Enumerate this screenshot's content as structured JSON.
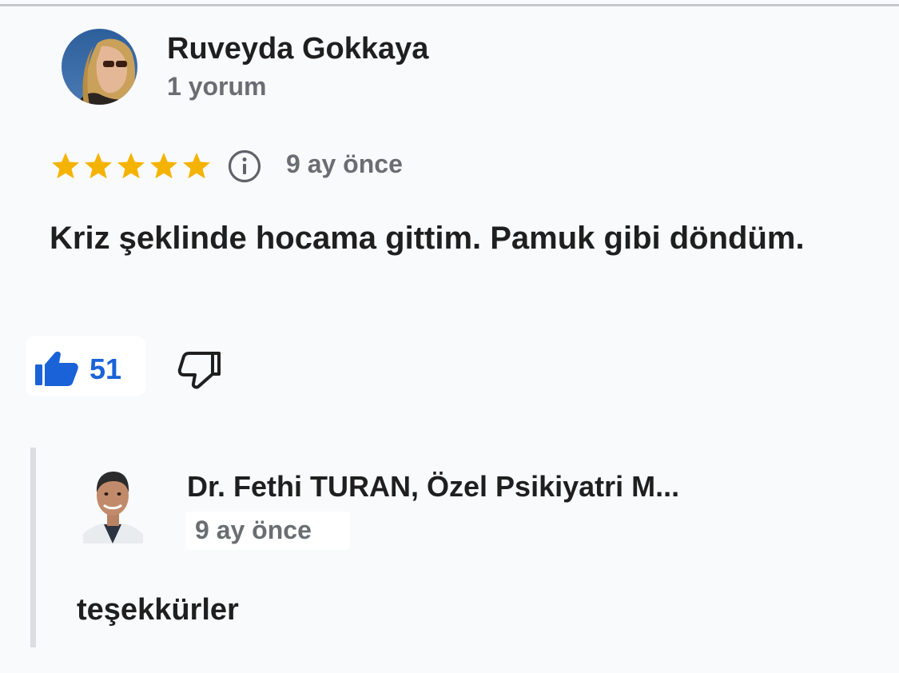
{
  "review": {
    "reviewer_name": "Ruveyda Gokkaya",
    "reviewer_meta": "1 yorum",
    "rating": 5,
    "rating_max": 5,
    "time": "9 ay önce",
    "text": "Kriz şeklinde hocama gittim. Pamuk gibi döndüm.",
    "like_count": "51",
    "star_color": "#f5b301",
    "like_color": "#1a62d8"
  },
  "reply": {
    "owner_name": "Dr. Fethi TURAN, Özel Psikiyatri M...",
    "time": "9 ay önce",
    "text": "teşekkürler"
  },
  "icons": {
    "star": "star-icon",
    "info": "info-icon",
    "like": "thumbs-up-icon",
    "dislike": "thumbs-down-icon"
  }
}
